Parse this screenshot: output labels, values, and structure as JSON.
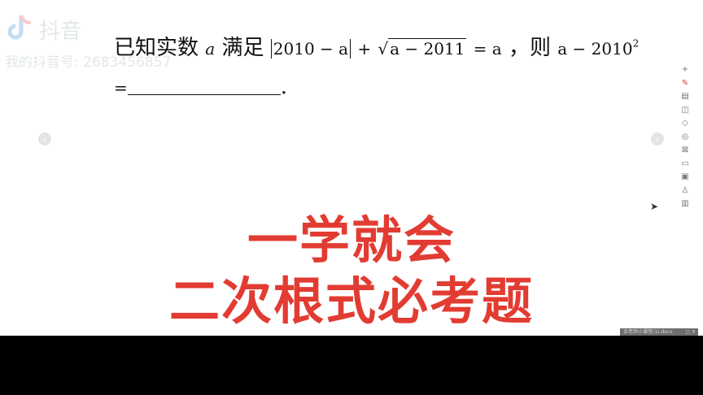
{
  "watermark": {
    "brand": "抖音",
    "user_id": "我的抖音号: 2683456857"
  },
  "question": {
    "prefix": "已知实数",
    "var_a": "a",
    "middle": "满足",
    "abs_expr": "2010 − a",
    "plus": "+",
    "sqrt_expr": "a − 2011",
    "equals_a": "= a",
    "then": "，则",
    "target_expr": "a − 2010",
    "exponent": "2",
    "line2_eq": "=",
    "line2_end": "."
  },
  "title": {
    "line1": "一学就会",
    "line2": "二次根式必考题"
  },
  "nav": {
    "prev": "‹",
    "next": "›"
  },
  "toolbar": {
    "icons": [
      "plus-icon",
      "pen-icon",
      "text-icon",
      "layers-icon",
      "eraser-icon",
      "target-icon",
      "crop-icon",
      "box-icon",
      "image-icon",
      "user-icon",
      "save-icon"
    ]
  },
  "colors": {
    "title": "#e23c32",
    "bottom_bar": "#000000"
  },
  "filebar": {
    "label": "余老师小课堂(1).docx",
    "controls": "▢ ✕"
  }
}
